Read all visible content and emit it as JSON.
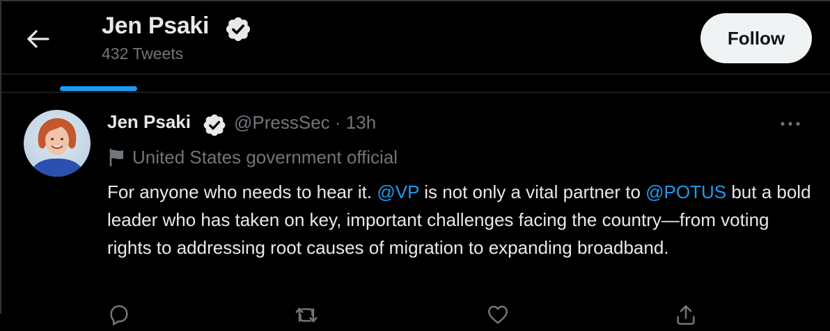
{
  "header": {
    "title": "Jen Psaki",
    "tweet_count": "432 Tweets",
    "follow_label": "Follow"
  },
  "tweet": {
    "author_name": "Jen Psaki",
    "handle": "@PressSec",
    "separator": "·",
    "timestamp": "13h",
    "label": "United States government official",
    "text_parts": {
      "p1": "For anyone who needs to hear it. ",
      "mention1": "@VP",
      "p2": " is not only a vital partner to ",
      "mention2": "@POTUS",
      "p3": " but a bold leader who has taken on key, important challenges facing the country—from voting rights to addressing root causes of migration to expanding broadband."
    },
    "actions": {
      "reply_count": "",
      "retweet_count": "",
      "like_count": ""
    }
  },
  "icons": {
    "back": "arrow-left-icon",
    "verified": "verified-badge-icon",
    "more": "more-dots-icon",
    "gov_label": "flag-icon",
    "reply": "reply-icon",
    "retweet": "retweet-icon",
    "like": "heart-icon",
    "share": "share-icon"
  },
  "colors": {
    "background": "#000000",
    "text": "#e7e9ea",
    "secondary": "#71767b",
    "accent": "#1d9bf0",
    "follow_bg": "#eff3f4",
    "border": "#2f3336"
  }
}
